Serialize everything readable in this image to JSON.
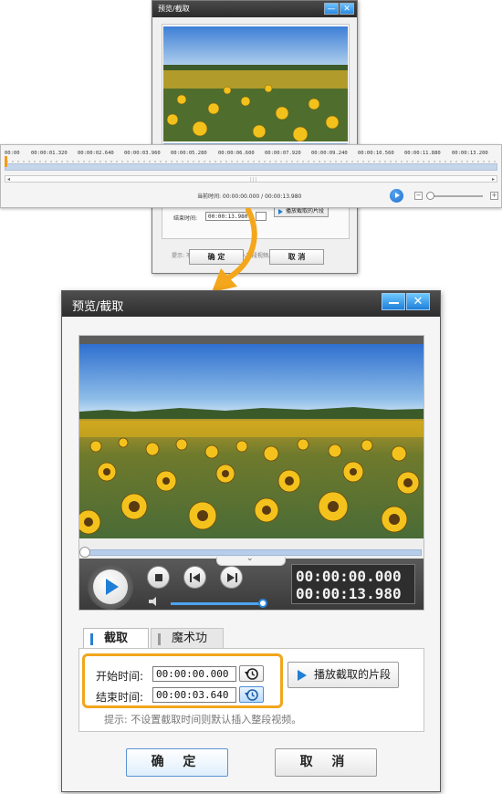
{
  "mini_window": {
    "title": "预览/截取",
    "min_symbol": "—",
    "close_symbol": "✕",
    "end_label": "结束时间:",
    "end_value": "00:00:13.980",
    "play_button": "播放截取的片段",
    "hint": "提示: 不设置截取时间默认插入整段视频。",
    "ok": "确 定",
    "cancel": "取 消"
  },
  "timeline": {
    "ticks": [
      "00:00",
      "00:00:01.320",
      "00:00:02.640",
      "00:00:03.960",
      "00:00:05.280",
      "00:00:06.600",
      "00:00:07.920",
      "00:00:09.240",
      "00:00:10.560",
      "00:00:11.880",
      "00:00:13.200"
    ],
    "current_time": "当前时间: 00:00:00.000 / 00:00:13.980",
    "grip": "|||",
    "left_arrow": "◂",
    "right_arrow": "▸",
    "zoom_minus": "−",
    "zoom_plus": "+"
  },
  "main_window": {
    "title": "预览/截取",
    "close_symbol": "✕",
    "collapse_symbol": "⌄",
    "current_time": "00:00:00.000",
    "total_time": "00:00:13.980",
    "volume": 0.95,
    "tabs": [
      {
        "label": "截取",
        "active": true
      },
      {
        "label": "魔术功能",
        "active": false
      }
    ],
    "start_label": "开始时间:",
    "start_value": "00:00:00.000",
    "end_label": "结束时间:",
    "end_value": "00:00:03.640",
    "play_segment_button": "播放截取的片段",
    "hint": "提示: 不设置截取时间则默认插入整段视频。",
    "ok_button": "确 定",
    "cancel_button": "取 消"
  },
  "colors": {
    "accent": "#1f7fd6",
    "highlight": "#f2a61c",
    "titlebar": "#3a3a3a",
    "time_display": "#2e2e2e"
  }
}
